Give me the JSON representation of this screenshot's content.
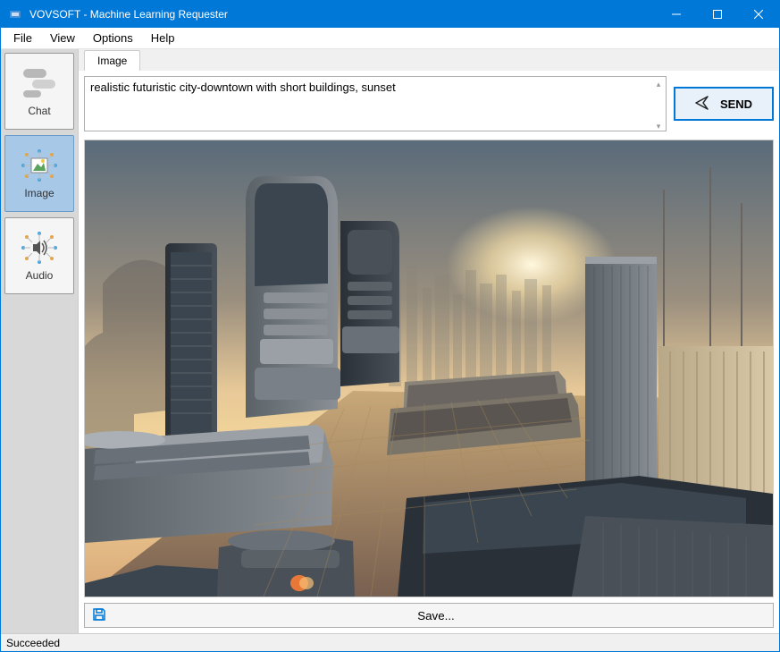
{
  "window": {
    "title": "VOVSOFT - Machine Learning Requester"
  },
  "menu": {
    "items": [
      "File",
      "View",
      "Options",
      "Help"
    ]
  },
  "sidebar": {
    "items": [
      {
        "label": "Chat",
        "icon": "chat-icon",
        "active": false
      },
      {
        "label": "Image",
        "icon": "image-icon",
        "active": true
      },
      {
        "label": "Audio",
        "icon": "audio-icon",
        "active": false
      }
    ]
  },
  "tabs": {
    "items": [
      "Image"
    ]
  },
  "prompt": {
    "value": "realistic futuristic city-downtown with short buildings, sunset"
  },
  "send": {
    "label": "SEND"
  },
  "save": {
    "label": "Save..."
  },
  "status": {
    "text": "Succeeded"
  }
}
